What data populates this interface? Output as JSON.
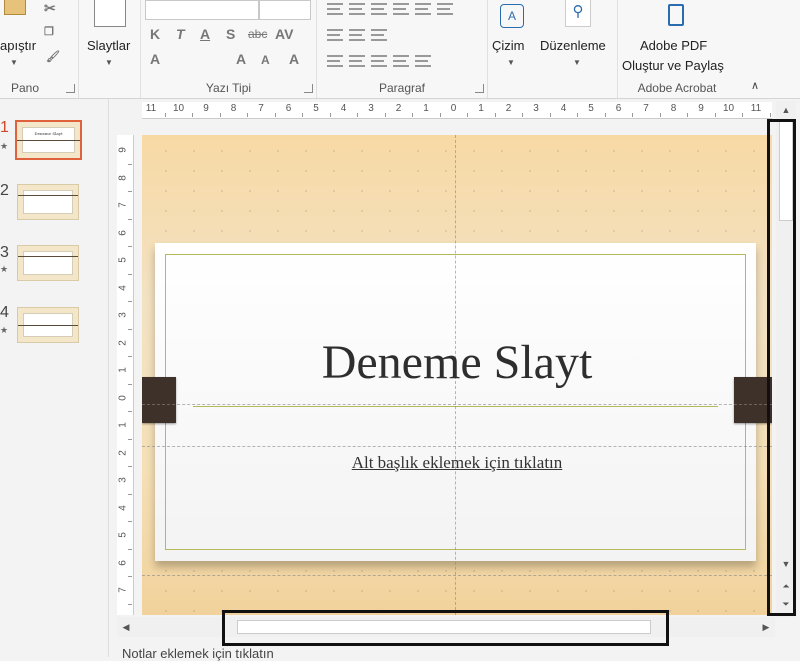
{
  "ribbon": {
    "pano": {
      "paste_label": "apıştır",
      "group_label": "Pano"
    },
    "slides": {
      "label": "Slaytlar"
    },
    "font": {
      "group_label": "Yazı Tipi",
      "bold": "K",
      "italic": "T",
      "underline": "A",
      "shadow": "S",
      "strike": "abc",
      "spacing": "AV",
      "color": "A",
      "grow": "A",
      "shrink": "A"
    },
    "paragraph": {
      "group_label": "Paragraf"
    },
    "drawing": {
      "label": "Çizim"
    },
    "editing": {
      "label": "Düzenleme"
    },
    "acrobat": {
      "line1": "Adobe PDF",
      "line2": "Oluştur ve Paylaş",
      "group_label": "Adobe Acrobat"
    }
  },
  "slides_panel": {
    "items": [
      {
        "number": "1",
        "star": "★",
        "active": true
      },
      {
        "number": "2",
        "star": "",
        "active": false
      },
      {
        "number": "3",
        "star": "★",
        "active": false
      },
      {
        "number": "4",
        "star": "★",
        "active": false
      }
    ],
    "thumb_title": "Deneme Slayt"
  },
  "ruler": {
    "horizontal": [
      "11",
      "10",
      "9",
      "8",
      "7",
      "6",
      "5",
      "4",
      "3",
      "2",
      "1",
      "0",
      "1",
      "2",
      "3",
      "4",
      "5",
      "6",
      "7",
      "8",
      "9",
      "10",
      "11"
    ],
    "vertical": [
      "9",
      "8",
      "7",
      "6",
      "5",
      "4",
      "3",
      "2",
      "1",
      "0",
      "1",
      "2",
      "3",
      "4",
      "5",
      "6",
      "7"
    ]
  },
  "slide": {
    "title": "Deneme Slayt",
    "subtitle": "Alt başlık eklemek için tıklatın"
  },
  "notes": {
    "text": "Notlar eklemek için tıklatın"
  },
  "colors": {
    "accent": "#d24726",
    "slide_bg": "#f5dfb5",
    "frame": "#b5b95a",
    "tab": "#3e3129"
  }
}
